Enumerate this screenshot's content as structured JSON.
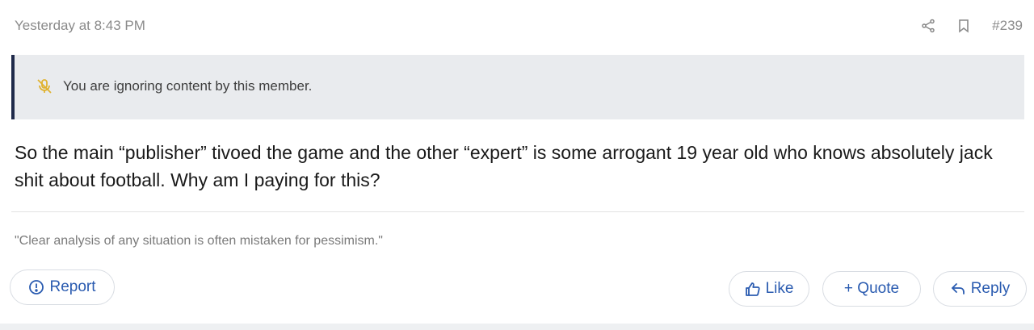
{
  "post": {
    "timestamp": "Yesterday at 8:43 PM",
    "post_number": "#239",
    "ignore_notice": "You are ignoring content by this member.",
    "message": "So the main “publisher” tivoed the game and the other “expert” is some arrogant 19 year old who knows absolutely jack shit about football. Why am I paying for this?",
    "signature": "\"Clear analysis of any situation is often mistaken for pessimism.\""
  },
  "actions": {
    "report_label": "Report",
    "like_label": "Like",
    "quote_label": "+ Quote",
    "reply_label": "Reply"
  },
  "icons": {
    "share": "share-icon",
    "bookmark": "bookmark-icon",
    "ignore": "mute-microphone-icon",
    "report": "exclamation-circle-icon",
    "like": "thumbs-up-icon",
    "reply": "reply-arrow-icon"
  },
  "colors": {
    "accent_blue": "#2a5bb0",
    "notice_bg": "#e9ebee",
    "notice_border": "#1f2a4a",
    "muted_text": "#8a8a8a",
    "ignore_icon": "#e0b230"
  }
}
